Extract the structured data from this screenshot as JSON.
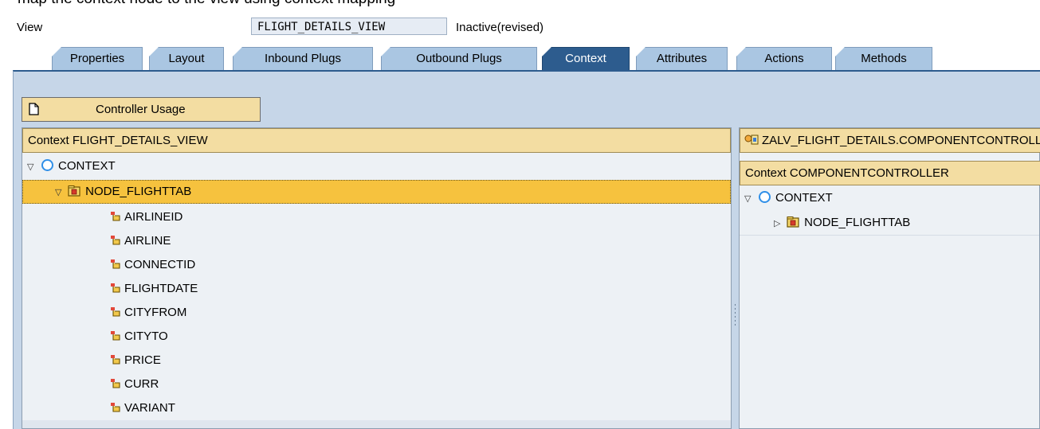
{
  "caption": "map the context node to the view using context mapping",
  "view_row": {
    "label": "View",
    "name": "FLIGHT_DETAILS_VIEW",
    "status": "Inactive(revised)"
  },
  "tabs": [
    {
      "label": "Properties"
    },
    {
      "label": "Layout"
    },
    {
      "label": "Inbound Plugs"
    },
    {
      "label": "Outbound Plugs"
    },
    {
      "label": "Context",
      "active": true
    },
    {
      "label": "Attributes"
    },
    {
      "label": "Actions"
    },
    {
      "label": "Methods"
    }
  ],
  "controller_usage": {
    "label": "Controller Usage",
    "icon": "document-icon"
  },
  "view_context": {
    "title": "Context FLIGHT_DETAILS_VIEW",
    "root": "CONTEXT",
    "node": "NODE_FLIGHTTAB",
    "attributes": [
      "AIRLINEID",
      "AIRLINE",
      "CONNECTID",
      "FLIGHTDATE",
      "CITYFROM",
      "CITYTO",
      "PRICE",
      "CURR",
      "VARIANT"
    ]
  },
  "component_context": {
    "component": "ZALV_FLIGHT_DETAILS.COMPONENTCONTROLLER",
    "title": "Context COMPONENTCONTROLLER",
    "root": "CONTEXT",
    "node": "NODE_FLIGHTTAB"
  },
  "colors": {
    "tab_active": "#2d5c8e",
    "tab_inactive": "#aac6e2",
    "header_bg": "#f3dda2",
    "selected_row": "#f6c23e",
    "content_bg": "#c6d6e8"
  }
}
